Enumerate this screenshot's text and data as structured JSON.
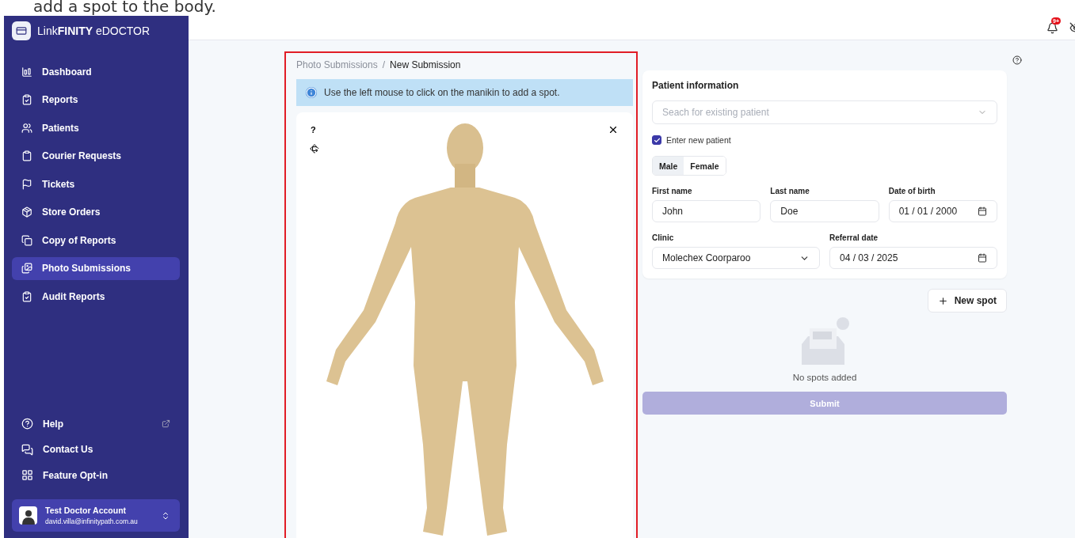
{
  "caption": "add a spot to the body.",
  "logo": {
    "light": "Link",
    "bold": "FINITY",
    "suffix": "eDOCTOR"
  },
  "nav": [
    {
      "label": "Dashboard",
      "selected": false
    },
    {
      "label": "Reports",
      "selected": false
    },
    {
      "label": "Patients",
      "selected": false
    },
    {
      "label": "Courier Requests",
      "selected": false
    },
    {
      "label": "Tickets",
      "selected": false
    },
    {
      "label": "Store Orders",
      "selected": false
    },
    {
      "label": "Copy of Reports",
      "selected": false
    },
    {
      "label": "Photo Submissions",
      "selected": true
    },
    {
      "label": "Audit Reports",
      "selected": false
    }
  ],
  "bottom_nav": [
    {
      "label": "Help",
      "external": true
    },
    {
      "label": "Contact Us",
      "external": false
    },
    {
      "label": "Feature Opt-in",
      "external": false
    }
  ],
  "account": {
    "name": "Test Doctor Account",
    "email": "david.villa@infinitypath.com.au"
  },
  "header": {
    "notification_badge": "9+"
  },
  "breadcrumb_separator": "/",
  "breadcrumb": [
    {
      "label": "Photo Submissions",
      "selected": false
    },
    {
      "label": "New Submission",
      "selected": true
    }
  ],
  "info": "Use the left mouse to click on the manikin to add a spot.",
  "viewer": {
    "help": "?"
  },
  "patient": {
    "title": "Patient information",
    "search": {
      "placeholder": "Seach for existing patient"
    },
    "new_patient": {
      "label": "Enter new patient",
      "checked": true
    },
    "sex": [
      {
        "label": "Male",
        "selected": true
      },
      {
        "label": "Female",
        "selected": false
      }
    ],
    "row1": [
      {
        "kind": "text",
        "label": "First name",
        "value": "John"
      },
      {
        "kind": "text",
        "label": "Last name",
        "value": "Doe"
      },
      {
        "kind": "date",
        "label": "Date of birth",
        "value": "01 / 01 / 2000"
      }
    ],
    "row2": [
      {
        "kind": "select",
        "label": "Clinic",
        "value": "Molechex Coorparoo"
      },
      {
        "kind": "date",
        "label": "Referral date",
        "value": "04 / 03 / 2025"
      }
    ]
  },
  "new_spot": "New spot",
  "empty": "No spots added",
  "submit": {
    "label": "Submit",
    "disabled": true
  }
}
